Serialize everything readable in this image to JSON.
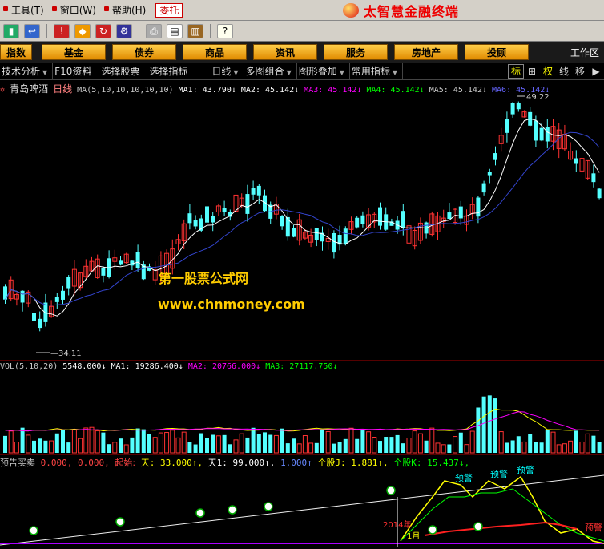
{
  "menu": [
    "工具(T)",
    "窗口(W)",
    "帮助(H)"
  ],
  "weituo": "委托",
  "brand": "太智慧金融终端",
  "toolbar_icons": [
    "chart-icon",
    "back-icon",
    "alert-icon",
    "diamond-icon",
    "refresh-icon",
    "settings-icon",
    "print-icon",
    "window-icon",
    "books-icon",
    "cursor-help-icon"
  ],
  "categories": [
    "指数",
    "基金",
    "债券",
    "商品",
    "资讯",
    "服务",
    "房地产",
    "投顾"
  ],
  "workarea": "工作区",
  "tabs": [
    "技术分析",
    "F10资料",
    "选择股票",
    "选择指标",
    "日线",
    "多图组合",
    "图形叠加",
    "常用指标"
  ],
  "right_tabs": [
    "标",
    "⊞",
    "权",
    "线",
    "移",
    "▶"
  ],
  "stock": {
    "name": "青岛啤酒",
    "period": "日线",
    "ma_label": "MA(5,10,10,10,10,10)",
    "ma1": "MA1: 43.790↓",
    "ma2": "MA2: 45.142↓",
    "ma3": "MA3: 45.142↓",
    "ma4": "MA4: 45.142↓",
    "ma5": "MA5: 45.142↓",
    "ma6": "MA6: 45.142↓",
    "high_label": "49.22",
    "low_label": "34.11"
  },
  "volume": {
    "label": "VOL(5,10,20)",
    "vol": "5548.000↓",
    "ma1": "MA1: 19286.400↓",
    "ma2": "MA2: 20766.000↓",
    "ma3": "MA3: 27117.750↓"
  },
  "indicator": {
    "name": "预告买卖",
    "v1": "0.000,",
    "v2": "0.000,",
    "qishi": "起始:",
    "tian1": "天: 33.000↑,",
    "tian2": "天1: 99.000↑,",
    "v3": "1.000↑",
    "gj": "个股J: 1.881↑,",
    "gk": "个股K: 15.437↓,",
    "yujing": [
      "预警",
      "预警",
      "预警",
      "预警"
    ],
    "year_label": "2014年",
    "month_label": "1月"
  },
  "watermark": {
    "line1": "第一股票公式网",
    "line2": "www.chnmoney.com"
  },
  "colors": {
    "up": "#ff3232",
    "down": "#54ffff",
    "ma1": "#ffffff",
    "ma2": "#ffff00",
    "ma3": "#ff00ff",
    "ma4": "#00ff00",
    "ma5": "#c0c0c0",
    "vol_ma1": "#ffffff",
    "vol_ma2": "#ffff00",
    "vol_ma3": "#ff00ff"
  }
}
